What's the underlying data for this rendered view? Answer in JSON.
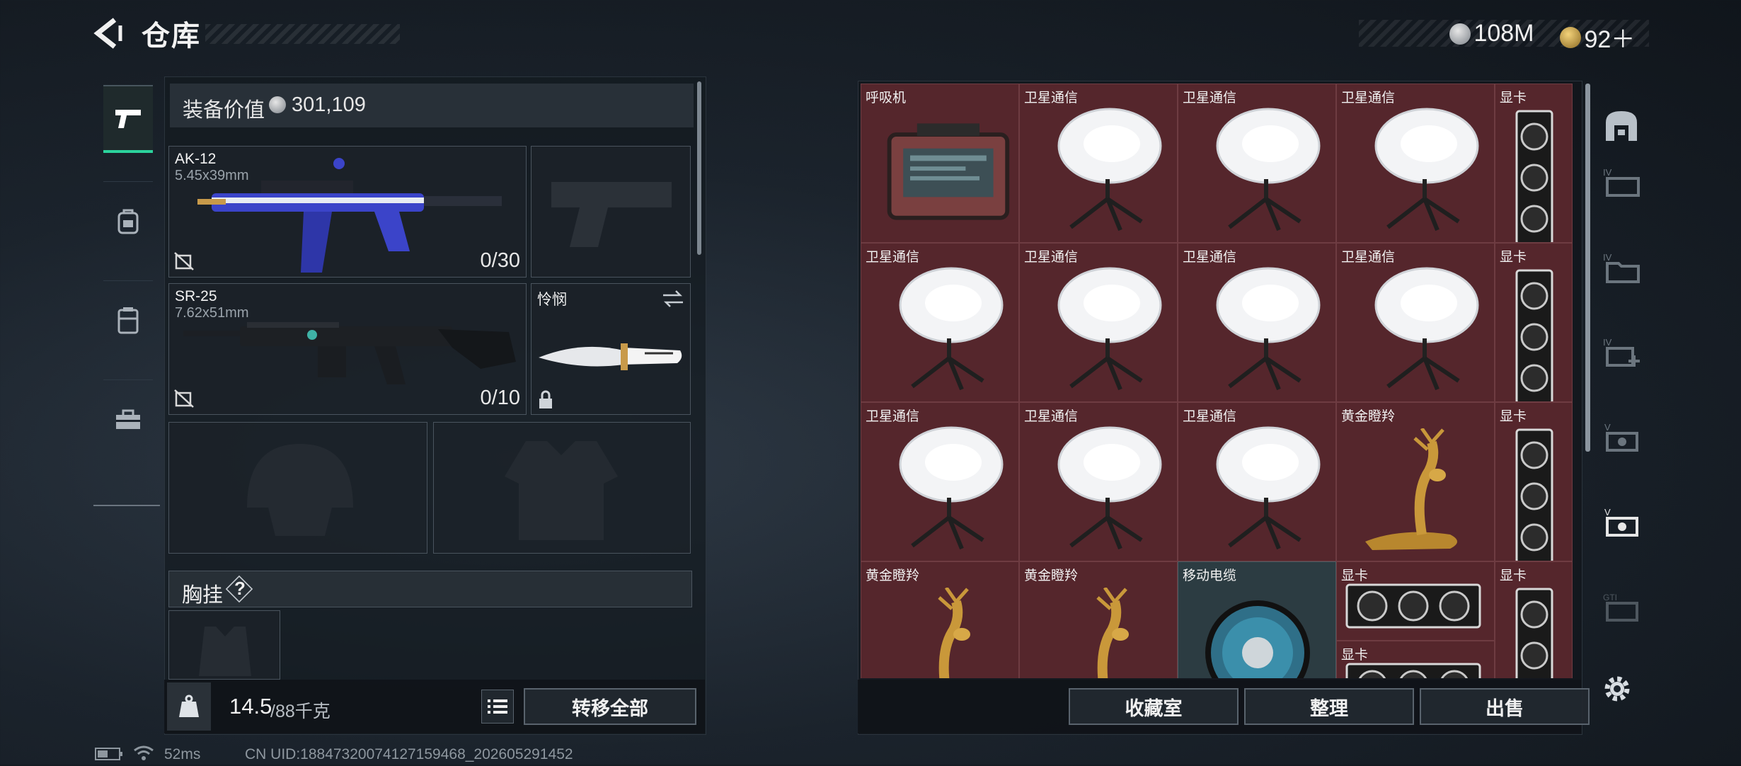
{
  "header": {
    "title": "仓库",
    "currency_main": "108M",
    "currency_secondary": "92＋"
  },
  "equipment": {
    "value_label": "装备价值",
    "value": "301,109",
    "primary_weapon": {
      "name": "AK-12",
      "caliber": "5.45x39mm",
      "ammo": "0/30"
    },
    "secondary_weapon": {
      "name": "SR-25",
      "caliber": "7.62x51mm",
      "ammo": "0/10"
    },
    "melee": {
      "name": "怜悯"
    },
    "chest_rig_label": "胸挂",
    "chest_rig_help": "?"
  },
  "weight": {
    "current": "14.5",
    "max": "/88千克"
  },
  "buttons": {
    "transfer_all": "转移全部",
    "collection": "收藏室",
    "organize": "整理",
    "sell": "出售"
  },
  "storage_items": [
    {
      "label": "呼吸机",
      "type": "ventilator"
    },
    {
      "label": "卫星通信",
      "type": "satellite"
    },
    {
      "label": "卫星通信",
      "type": "satellite"
    },
    {
      "label": "卫星通信",
      "type": "satellite"
    },
    {
      "label": "显卡",
      "type": "gpu-vertical"
    },
    {
      "label": "卫星通信",
      "type": "satellite"
    },
    {
      "label": "卫星通信",
      "type": "satellite"
    },
    {
      "label": "卫星通信",
      "type": "satellite"
    },
    {
      "label": "卫星通信",
      "type": "satellite"
    },
    {
      "label": "显卡",
      "type": "gpu-vertical"
    },
    {
      "label": "卫星通信",
      "type": "satellite"
    },
    {
      "label": "卫星通信",
      "type": "satellite"
    },
    {
      "label": "卫星通信",
      "type": "satellite"
    },
    {
      "label": "黄金瞪羚",
      "type": "gazelle"
    },
    {
      "label": "显卡",
      "type": "gpu-vertical"
    },
    {
      "label": "黄金瞪羚",
      "type": "gazelle"
    },
    {
      "label": "黄金瞪羚",
      "type": "gazelle"
    },
    {
      "label": "移动电缆",
      "type": "cable"
    },
    {
      "label": "显卡",
      "type": "gpu-horizontal"
    },
    {
      "label": "显卡",
      "type": "gpu-vertical"
    },
    {
      "label": "显卡",
      "type": "gpu-horizontal"
    }
  ],
  "footer": {
    "ping": "52ms",
    "uid": "CN UID:18847320074127159468_202605291452"
  }
}
